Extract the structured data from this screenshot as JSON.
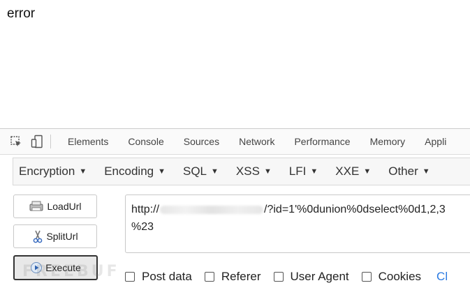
{
  "page": {
    "error_text": "error"
  },
  "devtools": {
    "tabs": [
      "Elements",
      "Console",
      "Sources",
      "Network",
      "Performance",
      "Memory",
      "Appli"
    ],
    "icons": [
      "inspect-element-icon",
      "device-toggle-icon"
    ]
  },
  "hackbar": {
    "menu": [
      "Encryption",
      "Encoding",
      "SQL",
      "XSS",
      "LFI",
      "XXE",
      "Other"
    ],
    "buttons": {
      "load": "LoadUrl",
      "split": "SplitUrl",
      "execute": "Execute"
    },
    "url": {
      "prefix": "http://",
      "suffix": "/?id=1'%0dunion%0dselect%0d1,2,3",
      "line2": "%23"
    },
    "options": [
      "Post data",
      "Referer",
      "User Agent",
      "Cookies"
    ],
    "clear_label": "Cl"
  },
  "watermark": "FREEBUF"
}
